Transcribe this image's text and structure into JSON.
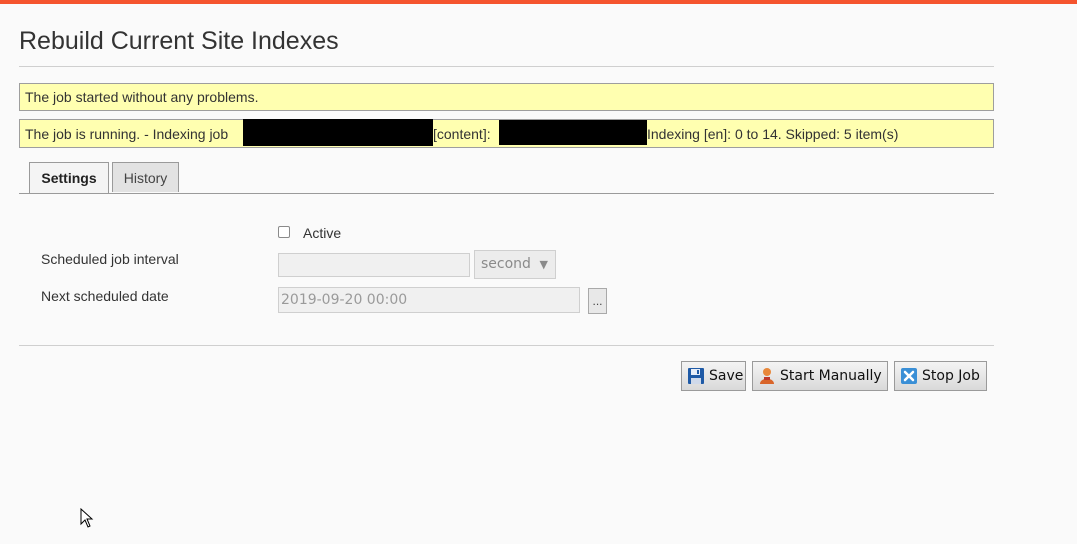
{
  "page": {
    "title": "Rebuild Current Site Indexes",
    "accent_color": "#f5542e"
  },
  "messages": {
    "started": "The job started without any problems.",
    "running_part1": "The job is running. - Indexing job",
    "running_part2": "[content]:",
    "running_part3": "Indexing [en]: 0 to 14. Skipped: 5 item(s)",
    "message_bg_color": "#ffffb0"
  },
  "tabs": [
    {
      "label": "Settings",
      "active": true
    },
    {
      "label": "History",
      "active": false
    }
  ],
  "form": {
    "active_label": "Active",
    "active_checked": false,
    "interval_label": "Scheduled job interval",
    "interval_value": "",
    "interval_unit": "second",
    "next_date_label": "Next scheduled date",
    "next_date_value": "2019-09-20 00:00",
    "date_picker_label": "..."
  },
  "buttons": {
    "save": {
      "label": "Save",
      "icon": "floppy-disk-icon"
    },
    "start": {
      "label": "Start Manually",
      "icon": "user-person-icon"
    },
    "stop": {
      "label": "Stop Job",
      "icon": "stop-x-icon"
    }
  }
}
